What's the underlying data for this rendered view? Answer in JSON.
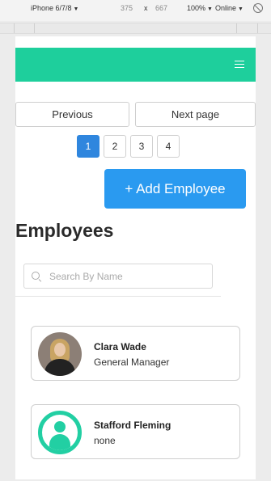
{
  "devtools": {
    "device": "iPhone 6/7/8",
    "width": "375",
    "times": "x",
    "height": "667",
    "zoom": "100%",
    "network": "Online",
    "caret": "▼"
  },
  "pagination": {
    "previous_label": "Previous",
    "next_label": "Next page",
    "pages": [
      "1",
      "2",
      "3",
      "4"
    ],
    "active_page": "1"
  },
  "add_button_label": "+ Add Employee",
  "page_title": "Employees",
  "search": {
    "placeholder": "Search By Name"
  },
  "employees": [
    {
      "name": "Clara Wade",
      "role": "General Manager",
      "avatar": "photo"
    },
    {
      "name": "Stafford Fleming",
      "role": "none",
      "avatar": "user-placeholder-icon"
    }
  ],
  "colors": {
    "navbar": "#1ecf9c",
    "primary_button": "#2a9af0",
    "active_page": "#2f86de",
    "placeholder_avatar": "#22cfa3"
  }
}
